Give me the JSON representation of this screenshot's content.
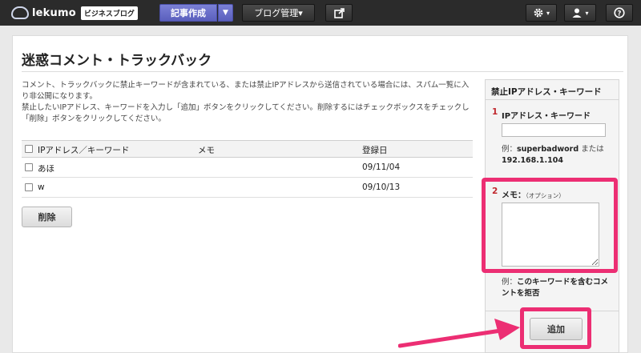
{
  "topbar": {
    "logo_text": "lekumo",
    "logo_badge": "ビジネスブログ",
    "compose_label": "記事作成",
    "compose_caret": "▼",
    "blog_manage_label": "ブログ管理▾",
    "icons": {
      "external": "external-link-icon",
      "gear": "gear-icon",
      "user": "user-icon",
      "help": "help-icon"
    }
  },
  "page": {
    "title": "迷惑コメント・トラックバック",
    "description": "コメント、トラックバックに禁止キーワードが含まれている、または禁止IPアドレスから送信されている場合には、スパム一覧に入り非公開になります。\n禁止したいIPアドレス、キーワードを入力し「追加」ボタンをクリックしてください。削除するにはチェックボックスをチェックし「削除」ボタンをクリックしてください。"
  },
  "table": {
    "headers": [
      "IPアドレス／キーワード",
      "メモ",
      "登録日"
    ],
    "rows": [
      {
        "keyword": "あほ",
        "memo": "",
        "date": "09/11/04"
      },
      {
        "keyword": "w",
        "memo": "",
        "date": "09/10/13"
      }
    ],
    "delete_label": "削除"
  },
  "sidebar": {
    "title": "禁止IPアドレス・キーワード",
    "step1_num": "1",
    "step1_label": "IPアドレス・キーワード",
    "step1_hint_prefix": "例：",
    "step1_hint_example1": "superbadword",
    "step1_hint_mid": " または",
    "step1_hint_example2": "192.168.1.104",
    "step2_num": "2",
    "step2_label": "メモ：",
    "step2_optional": "（オプション）",
    "step2_hint_prefix": "例：",
    "step2_hint_text": "このキーワードを含むコメントを拒否",
    "add_label": "追加"
  },
  "annotation": {
    "color": "#ec2e73"
  }
}
